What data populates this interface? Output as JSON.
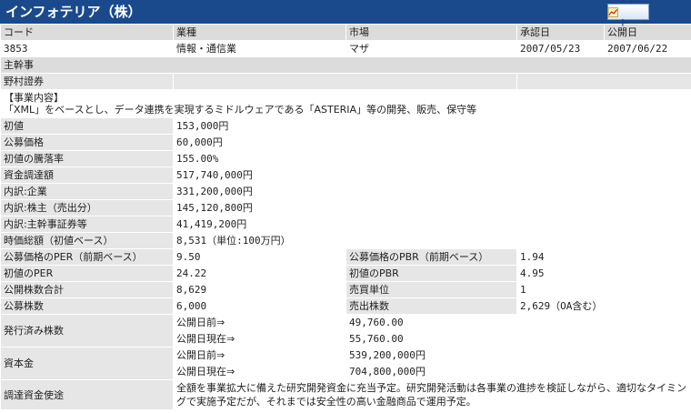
{
  "title": "インフォテリア（株）",
  "chart_button": {
    "label": "チャート",
    "icon": "chart-icon"
  },
  "header_row": {
    "code_label": "コード",
    "industry_label": "業種",
    "market_label": "市場",
    "approval_label": "承認日",
    "listing_label": "公開日"
  },
  "info_row": {
    "code": "3853",
    "industry": "情報・通信業",
    "market": "マザ",
    "approval_date": "2007/05/23",
    "listing_date": "2007/06/22"
  },
  "underwriter": {
    "label": "主幹事",
    "value": "野村證券"
  },
  "business": {
    "label": "【事業内容】",
    "text": "「XML」をベースとし、データ連携を実現するミドルウェアである「ASTERIA」等の開発、販売、保守等"
  },
  "rows": [
    {
      "label": "初値",
      "value": "153,000円"
    },
    {
      "label": "公募価格",
      "value": "60,000円"
    },
    {
      "label": "初値の騰落率",
      "value": "155.00%"
    },
    {
      "label": "資金調達額",
      "value": "517,740,000円"
    },
    {
      "label": "内訳:企業",
      "value": "331,200,000円"
    },
    {
      "label": "内訳:株主（売出分）",
      "value": "145,120,800円"
    },
    {
      "label": "内訳:主幹事証券等",
      "value": "41,419,200円"
    },
    {
      "label": "時価総額（初値ベース）",
      "value": "8,531（単位:100万円）"
    }
  ],
  "pair_rows": [
    {
      "l1": "公募価格のPER（前期ベース）",
      "v1": "9.50",
      "l2": "公募価格のPBR（前期ベース）",
      "v2": "1.94"
    },
    {
      "l1": "初値のPER",
      "v1": "24.22",
      "l2": "初値のPBR",
      "v2": "4.95"
    },
    {
      "l1": "公開株数合計",
      "v1": "8,629",
      "l2": "売買単位",
      "v2": "1"
    },
    {
      "l1": "公募株数",
      "v1": "6,000",
      "l2": "売出株数",
      "v2": "2,629（OA含む）"
    }
  ],
  "issued_shares": {
    "label": "発行済み株数",
    "before_label": "公開日前⇒",
    "before_value": "49,760.00",
    "after_label": "公開日現在⇒",
    "after_value": "55,760.00"
  },
  "capital": {
    "label": "資本金",
    "before_label": "公開日前⇒",
    "before_value": "539,200,000円",
    "after_label": "公開日現在⇒",
    "after_value": "704,800,000円"
  },
  "fund_use": {
    "label": "調達資金使途",
    "text": "全額を事業拡大に備えた研究開発資金に充当予定。研究開発活動は各事業の進捗を検証しながら、適切なタイミングで実施予定だが、それまでは安全性の高い金融商品で運用予定。"
  }
}
